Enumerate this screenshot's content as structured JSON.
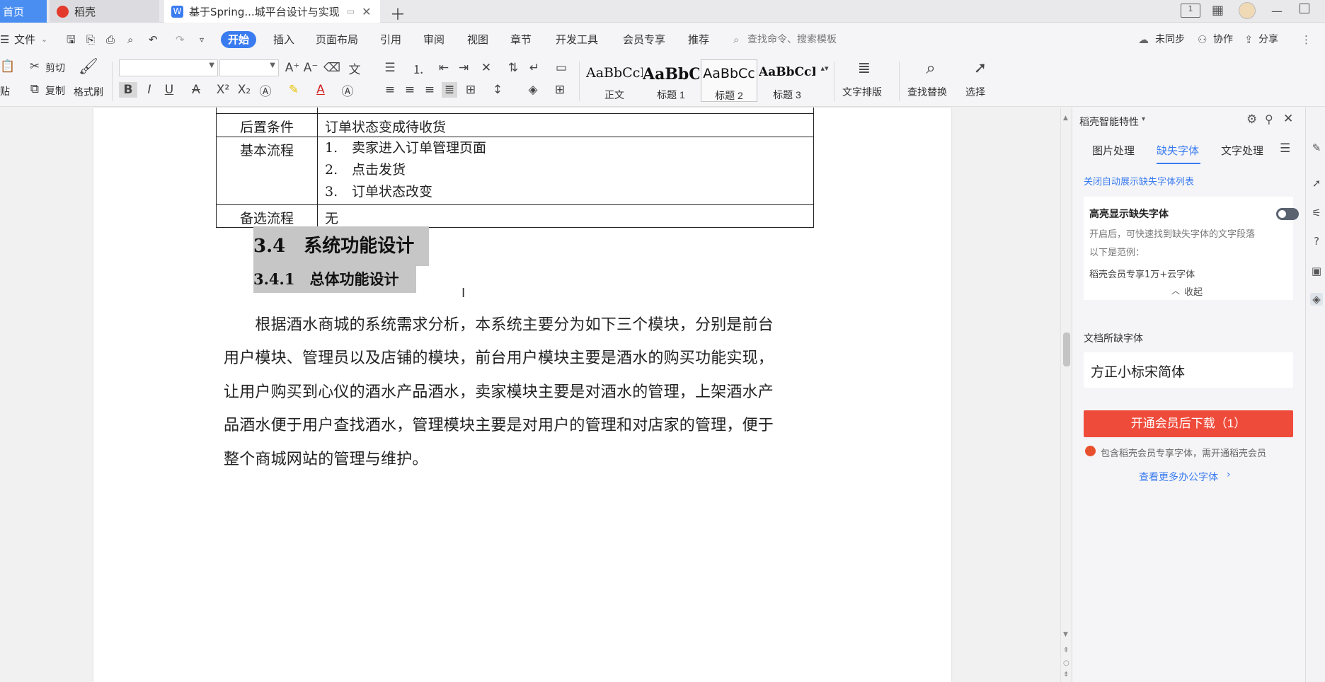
{
  "tabs": {
    "home": "首页",
    "daoke": "稻壳",
    "document": "基于Spring...城平台设计与实现"
  },
  "menubar": {
    "file": "文件",
    "items": [
      "开始",
      "插入",
      "页面布局",
      "引用",
      "审阅",
      "视图",
      "章节",
      "开发工具",
      "会员专享",
      "推荐"
    ],
    "search_placeholder": "查找命令、搜索模板",
    "sync": "未同步",
    "collab": "协作",
    "share": "分享"
  },
  "ribbon": {
    "cut": "剪切",
    "copy": "复制",
    "paste": "粘贴",
    "format_painter": "格式刷",
    "styles": [
      {
        "preview": "AaBbCcI",
        "label": "正文"
      },
      {
        "preview": "AaBbC",
        "label": "标题 1"
      },
      {
        "preview": "AaBbCc",
        "label": "标题 2"
      },
      {
        "preview": "AaBbCcI",
        "label": "标题 3"
      }
    ],
    "text_layout": "文字排版",
    "find_replace": "查找替换",
    "select": "选择"
  },
  "document": {
    "table": {
      "postcondition_label": "后置条件",
      "postcondition_value": "订单状态变成待收货",
      "basic_flow_label": "基本流程",
      "basic_flow_steps": [
        {
          "num": "1.",
          "text": "卖家进入订单管理页面"
        },
        {
          "num": "2.",
          "text": "点击发货"
        },
        {
          "num": "3.",
          "text": "订单状态改变"
        }
      ],
      "alt_flow_label": "备选流程",
      "alt_flow_value": "无"
    },
    "heading_34": "3.4　系统功能设计",
    "heading_341": "3.4.1　总体功能设计",
    "paragraph_lines": [
      "　　根据酒水商城的系统需求分析，本系统主要分为如下三个模块，分别是前台",
      "用户模块、管理员以及店铺的模块，前台用户模块主要是酒水的购买功能实现，",
      "让用户购买到心仪的酒水产品酒水，卖家模块主要是对酒水的管理，上架酒水产",
      "品酒水便于用户查找酒水，管理模块主要是对用户的管理和对店家的管理，便于",
      "整个商城网站的管理与维护。"
    ]
  },
  "panel": {
    "title": "稻壳智能特性",
    "tabs": [
      "图片处理",
      "缺失字体",
      "文字处理"
    ],
    "close_auto_link": "关闭自动展示缺失字体列表",
    "highlight_title": "高亮显示缺失字体",
    "highlight_desc": "开启后，可快速找到缺失字体的文字段落",
    "example_label": "以下是范例：",
    "example_text": "稻壳会员专享1万+云字体",
    "collapse": "收起",
    "missing_fonts_title": "文档所缺字体",
    "missing_font": "方正小标宋简体",
    "download_button": "开通会员后下载（1）",
    "member_note": "包含稻壳会员专享字体，需开通稻壳会员",
    "more_fonts_link": "查看更多办公字体"
  },
  "colors": {
    "accent": "#3a7cf0",
    "download": "#ef4b3b",
    "link": "#3a7cf0"
  }
}
